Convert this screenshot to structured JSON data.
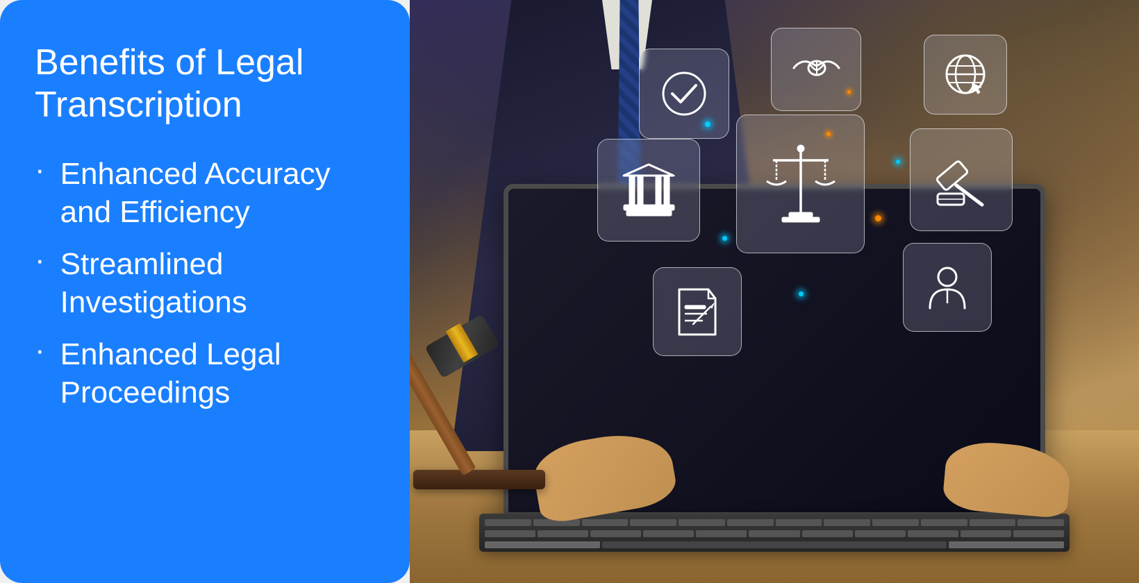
{
  "left_panel": {
    "background_color": "#1a7fff",
    "title_line1": "Benefits of Legal",
    "title_line2": "Transcription",
    "benefits": [
      {
        "id": "benefit-1",
        "text_line1": "Enhanced Accuracy",
        "text_line2": "and Efficiency"
      },
      {
        "id": "benefit-2",
        "text_line1": "Streamlined",
        "text_line2": "Investigations"
      },
      {
        "id": "benefit-3",
        "text_line1": "Enhanced Legal",
        "text_line2": "Proceedings"
      }
    ]
  },
  "right_panel": {
    "description": "Legal professional typing on laptop with floating legal icons",
    "icons": [
      {
        "name": "checkmark-icon",
        "symbol": "✓"
      },
      {
        "name": "handshake-icon",
        "symbol": "🤝"
      },
      {
        "name": "globe-icon",
        "symbol": "🌐"
      },
      {
        "name": "courthouse-icon",
        "symbol": "🏛"
      },
      {
        "name": "scales-icon",
        "symbol": "⚖"
      },
      {
        "name": "gavel-judge-icon",
        "symbol": "⚖"
      },
      {
        "name": "law-document-icon",
        "symbol": "📋"
      },
      {
        "name": "person-icon",
        "symbol": "👤"
      }
    ]
  }
}
